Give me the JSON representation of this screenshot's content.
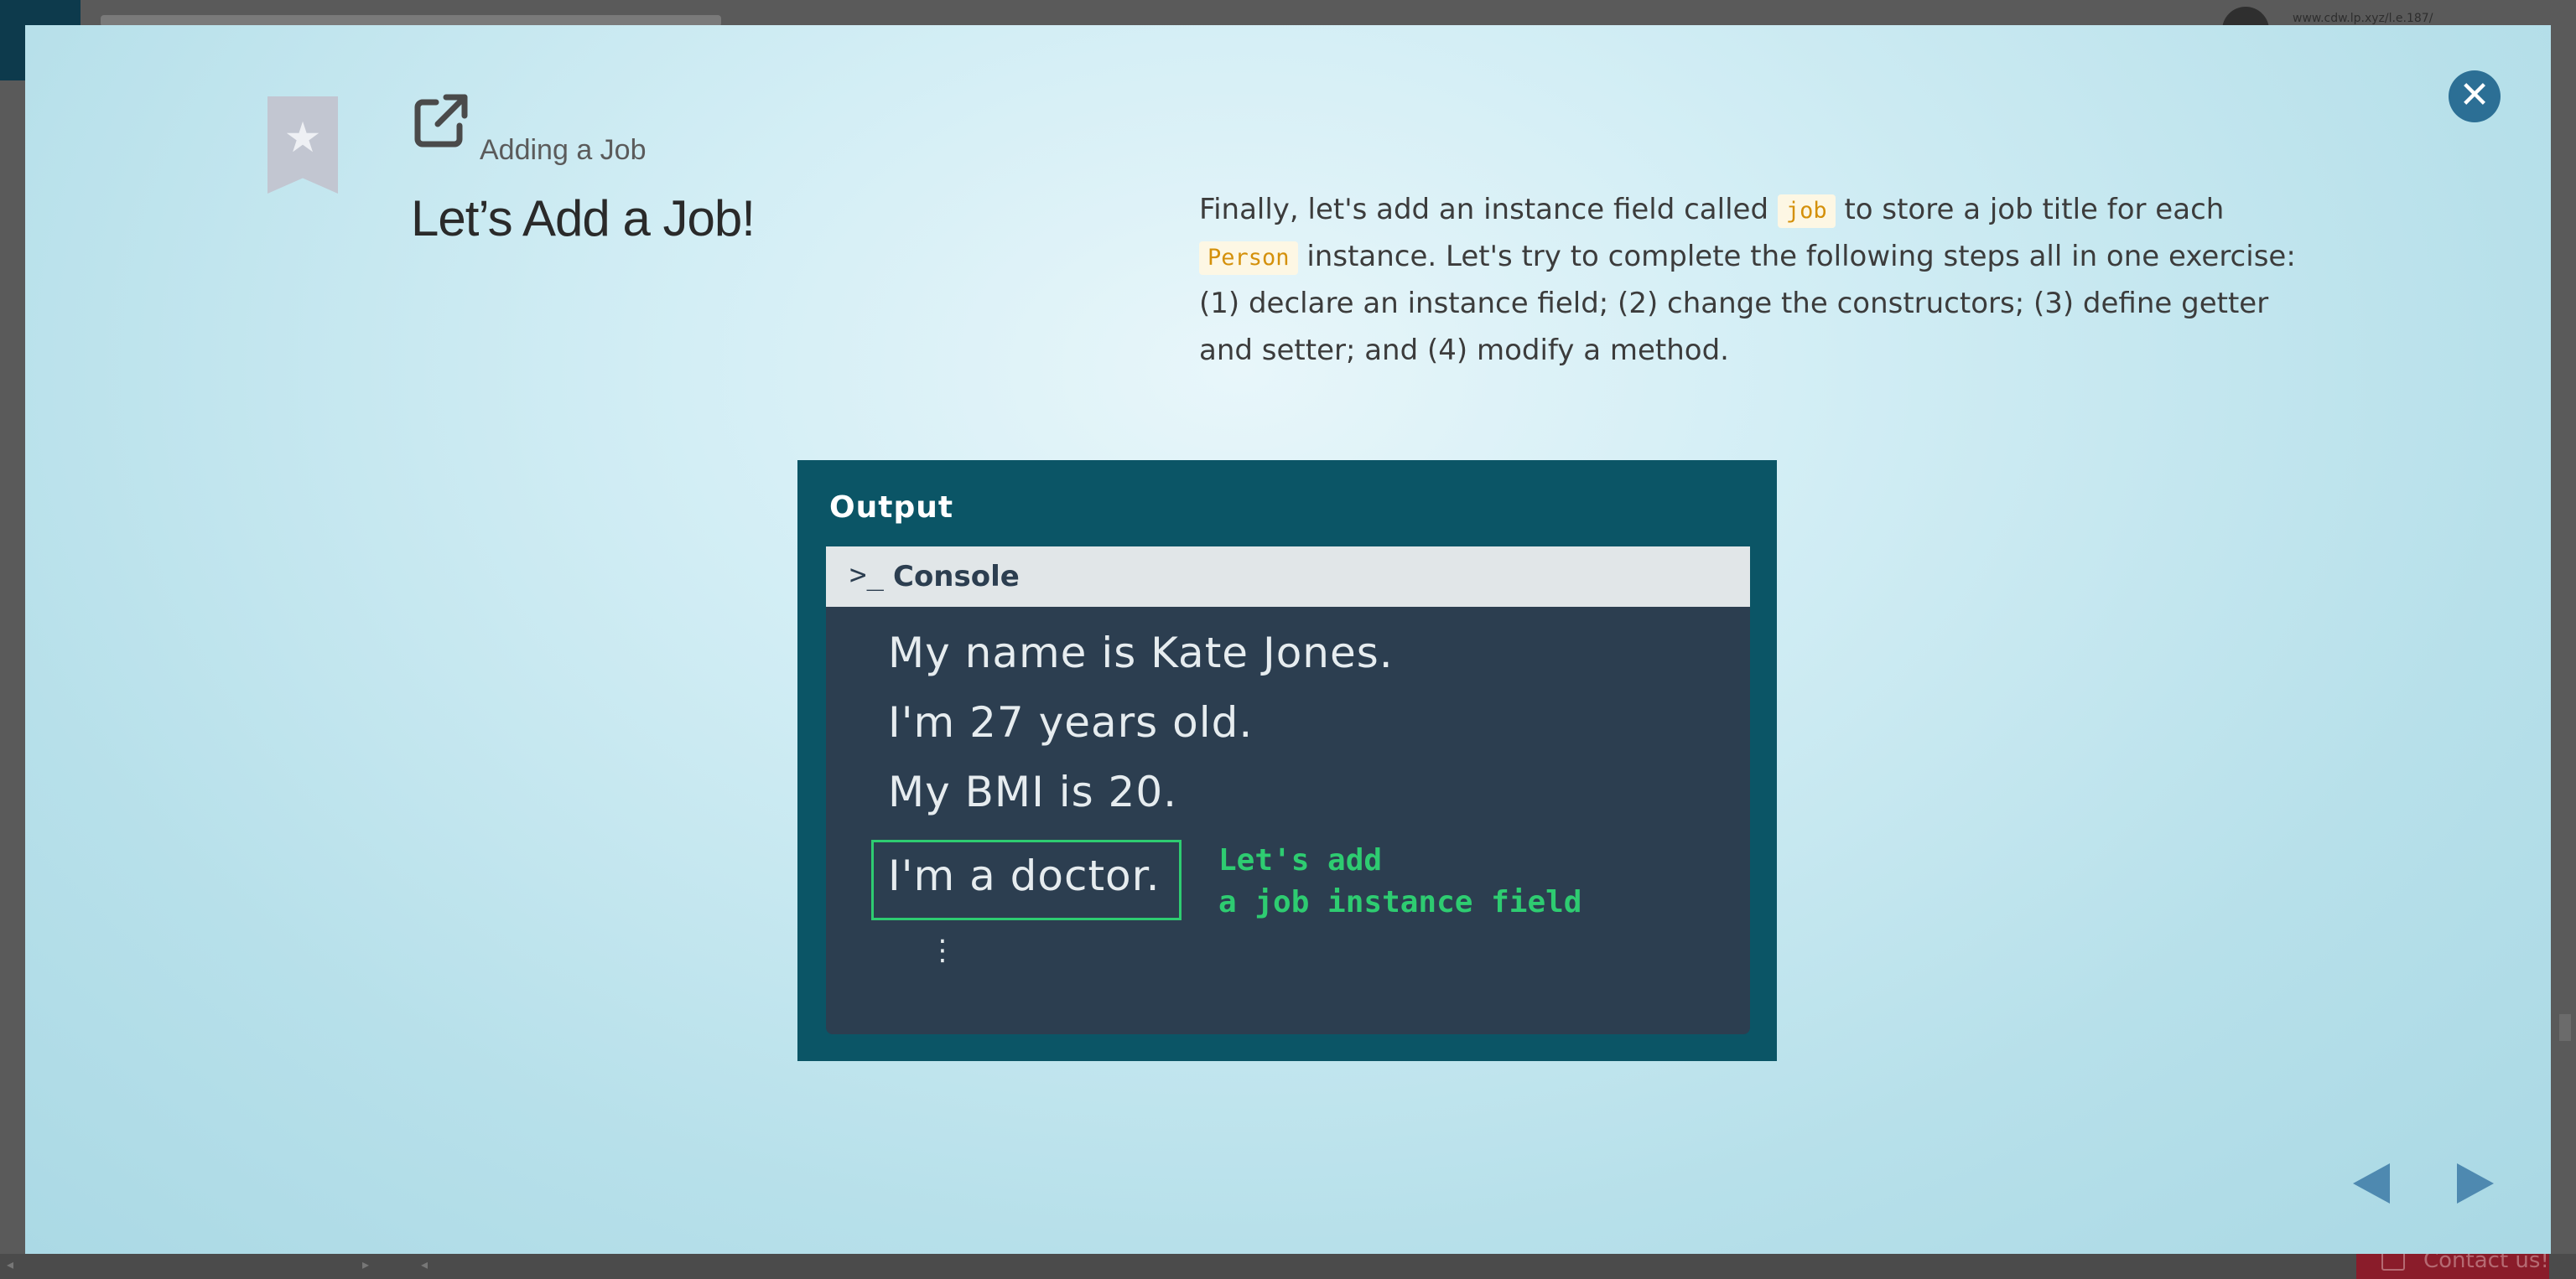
{
  "background": {
    "url_text": "www.cdw.lp.xyz/l.e.187/",
    "contact_label": "Contact us!"
  },
  "modal": {
    "close_icon": "close-icon",
    "bookmark_icon": "bookmark-star-icon",
    "external_link_icon": "external-link-icon",
    "subtitle": "Adding a Job",
    "title": "Let’s Add a Job!",
    "description": {
      "part1": "Finally, let's add an instance field called ",
      "code1": "job",
      "part2": " to store a job title for each ",
      "code2": "Person",
      "part3": " instance. Let's try to complete the following steps all in one exercise: (1) declare an instance field; (2) change the constructors; (3) define getter and setter; and (4) modify a method."
    },
    "output_image": {
      "header": "Output",
      "console_label": "Console",
      "console_icon": ">_",
      "lines": [
        "My name is Kate Jones.",
        "I'm 27 years old.",
        "My BMI is 20.",
        "I'm a doctor."
      ],
      "ellipsis": "⋮",
      "annotation_line1": "Let's add",
      "annotation_line2": "a job instance field"
    },
    "nav": {
      "prev_icon": "prev-arrow-icon",
      "next_icon": "next-arrow-icon"
    },
    "colors": {
      "accent": "#2c6f95",
      "code_text": "#d4900a",
      "highlight_green": "#2ecc71",
      "output_frame": "#0b5566"
    }
  }
}
